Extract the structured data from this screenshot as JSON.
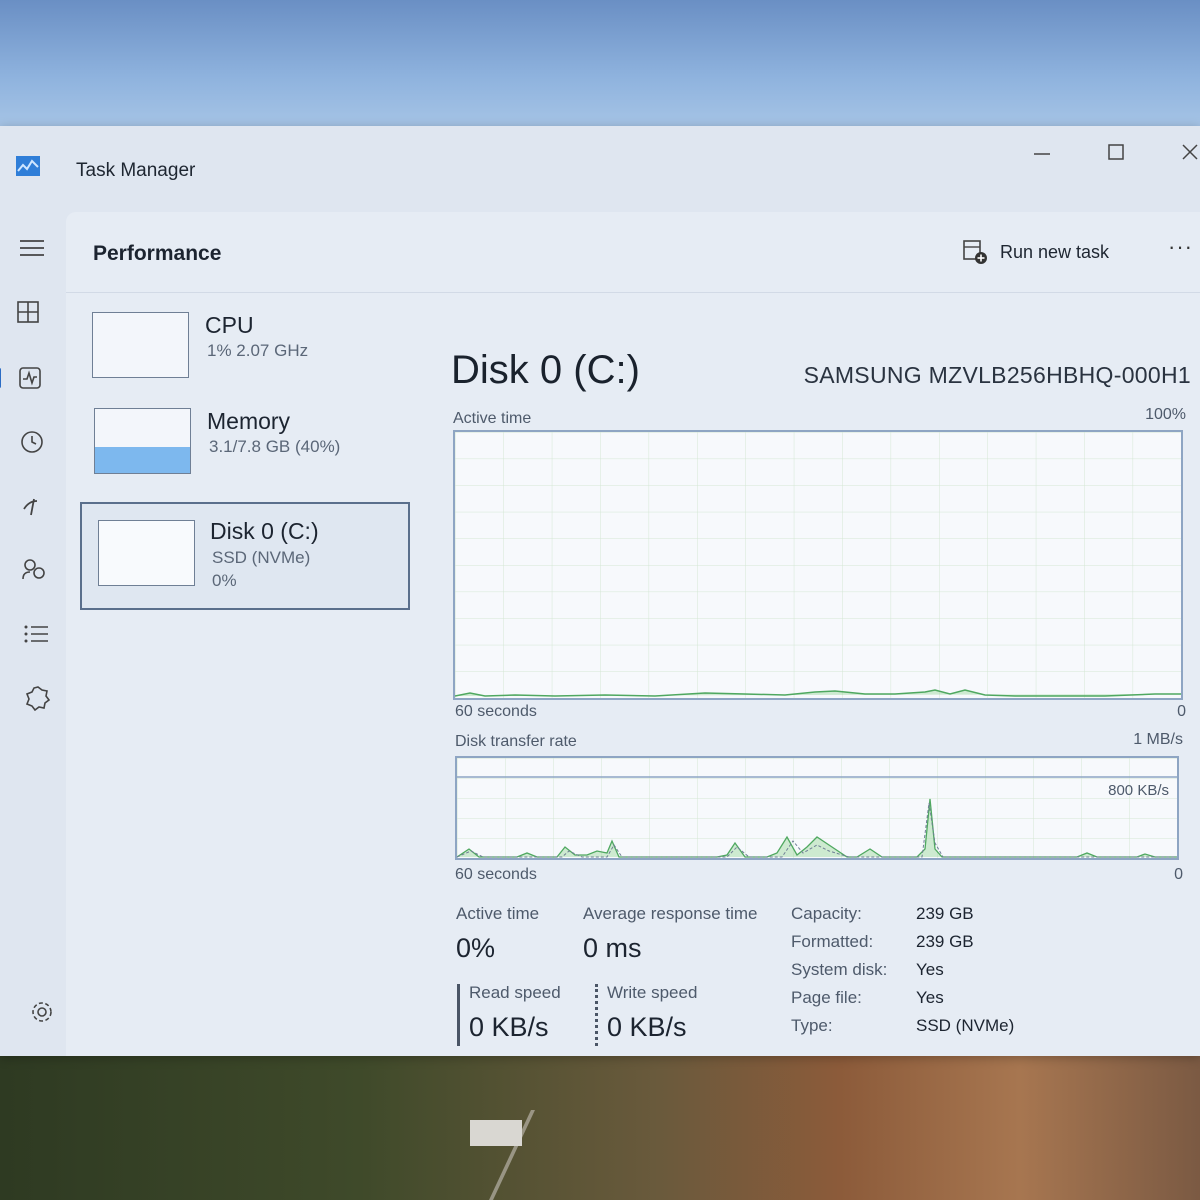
{
  "app": {
    "title": "Task Manager"
  },
  "header": {
    "title": "Performance",
    "run_task_label": "Run new task",
    "more_label": "···"
  },
  "devices": [
    {
      "name": "CPU",
      "line1": "1% 2.07 GHz",
      "line2": ""
    },
    {
      "name": "Memory",
      "line1": "3.1/7.8 GB (40%)",
      "line2": "",
      "usage_fraction": 0.4
    },
    {
      "name": "Disk 0 (C:)",
      "line1": "SSD (NVMe)",
      "line2": "0%"
    }
  ],
  "detail": {
    "title": "Disk 0 (C:)",
    "model": "SAMSUNG MZVLB256HBHQ-000H1",
    "active_graph": {
      "label": "Active time",
      "max_label": "100%",
      "span_label": "60 seconds",
      "min_label": "0"
    },
    "transfer_graph": {
      "label": "Disk transfer rate",
      "max_label": "1 MB/s",
      "mid_label": "800 KB/s",
      "span_label": "60 seconds",
      "min_label": "0"
    },
    "stats": {
      "active_time_label": "Active time",
      "active_time_value": "0%",
      "response_label": "Average response time",
      "response_value": "0 ms",
      "read_label": "Read speed",
      "read_value": "0 KB/s",
      "write_label": "Write speed",
      "write_value": "0 KB/s"
    },
    "properties": [
      {
        "key": "Capacity:",
        "value": "239 GB"
      },
      {
        "key": "Formatted:",
        "value": "239 GB"
      },
      {
        "key": "System disk:",
        "value": "Yes"
      },
      {
        "key": "Page file:",
        "value": "Yes"
      },
      {
        "key": "Type:",
        "value": "SSD (NVMe)"
      }
    ]
  },
  "colors": {
    "graph_border": "#8ea5c3",
    "graph_fill": "#7fcf7f",
    "accent": "#2b6cc4",
    "memory_fill": "#7db8ee"
  },
  "icons": [
    "app-icon",
    "minimize-icon",
    "maximize-icon",
    "close-icon",
    "menu-icon",
    "processes-icon",
    "performance-icon",
    "history-icon",
    "startup-icon",
    "users-icon",
    "details-icon",
    "services-icon",
    "settings-icon",
    "run-task-icon"
  ]
}
